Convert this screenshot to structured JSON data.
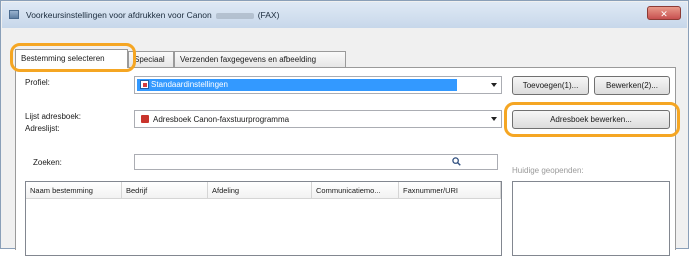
{
  "window": {
    "title_prefix": "Voorkeursinstellingen voor afdrukken voor Canon",
    "title_suffix": "(FAX)",
    "close_glyph": "✕"
  },
  "tabs": [
    {
      "label": "Bestemming selecteren",
      "active": true
    },
    {
      "label": "Speciaal",
      "active": false
    },
    {
      "label": "Verzenden faxgegevens en afbeelding",
      "active": false
    }
  ],
  "profile": {
    "label": "Profiel:",
    "value": "Standaardinstellingen",
    "add_button": "Toevoegen(1)...",
    "edit_button": "Bewerken(2)..."
  },
  "address_book": {
    "list_label": "Lijst adresboek:",
    "address_label": "Adreslijst:",
    "value": "Adresboek Canon-faxstuurprogramma",
    "edit_button": "Adresboek bewerken..."
  },
  "search": {
    "label": "Zoeken:",
    "value": ""
  },
  "destination_table": {
    "columns": [
      "Naam bestemming",
      "Bedrijf",
      "Afdeling",
      "Communicatiemo...",
      "Faxnummer/URI"
    ],
    "rows": []
  },
  "current_recipients": {
    "label": "Huidige geopenden:"
  },
  "colors": {
    "highlight": "#f5a623",
    "selection": "#3399ff",
    "address_book_icon": "#c9342c"
  }
}
